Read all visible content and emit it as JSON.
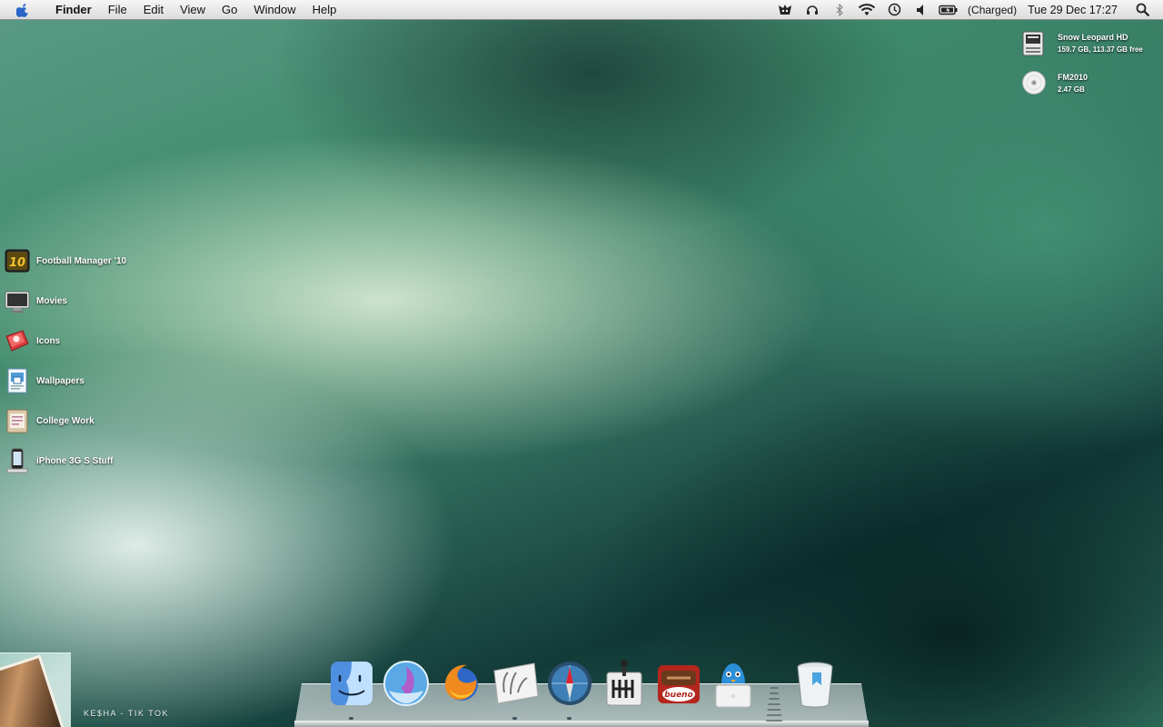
{
  "menubar": {
    "apple_icon": "apple-icon",
    "app_name": "Finder",
    "menus": [
      "File",
      "Edit",
      "View",
      "Go",
      "Window",
      "Help"
    ],
    "status_icons": [
      "growl-icon",
      "headphones-icon",
      "bluetooth-icon",
      "wifi-icon",
      "time-machine-icon",
      "volume-icon",
      "battery-icon"
    ],
    "battery_status": "(Charged)",
    "clock": "Tue 29 Dec  17:27",
    "spotlight_icon": "spotlight-icon"
  },
  "drives": [
    {
      "name": "Snow Leopard HD",
      "detail": "159.7 GB, 113.37 GB free",
      "icon": "hard-drive-icon"
    },
    {
      "name": "FM2010",
      "detail": "2.47 GB",
      "icon": "disc-icon"
    }
  ],
  "desktop_items": [
    {
      "label": "Football Manager '10",
      "icon": "football-manager-icon"
    },
    {
      "label": "Movies",
      "icon": "movies-folder-icon"
    },
    {
      "label": "Icons",
      "icon": "icons-folder-icon"
    },
    {
      "label": "Wallpapers",
      "icon": "wallpapers-folder-icon"
    },
    {
      "label": "College Work",
      "icon": "college-work-folder-icon"
    },
    {
      "label": "iPhone 3G S Stuff",
      "icon": "iphone-icon"
    }
  ],
  "now_playing": {
    "track": "KE$HA - TIK TOK"
  },
  "dock": {
    "apps": [
      {
        "name": "Finder",
        "icon": "finder-icon",
        "running": true
      },
      {
        "name": "Mail",
        "icon": "mail-icon",
        "running": false
      },
      {
        "name": "Firefox",
        "icon": "firefox-icon",
        "running": false
      },
      {
        "name": "Photo Booth",
        "icon": "photo-booth-icon",
        "running": true
      },
      {
        "name": "Safari",
        "icon": "safari-icon",
        "running": true
      },
      {
        "name": "System Preferences",
        "icon": "gear-shift-icon",
        "running": false
      },
      {
        "name": "Kinder Bueno",
        "icon": "bueno-icon",
        "running": false
      },
      {
        "name": "Twitter",
        "icon": "twitter-bird-icon",
        "running": false
      }
    ],
    "trash": {
      "name": "Trash",
      "icon": "trash-icon"
    }
  }
}
